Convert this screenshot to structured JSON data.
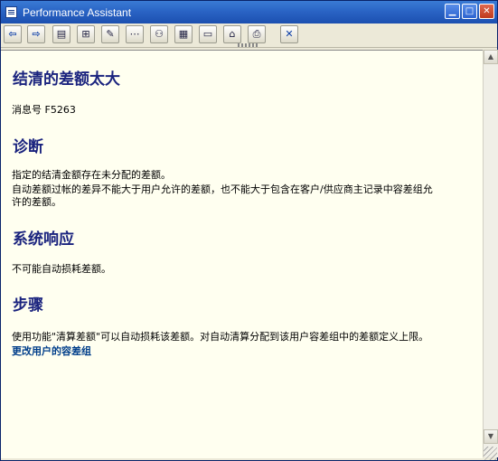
{
  "window": {
    "title": "Performance Assistant"
  },
  "window_controls": {
    "minimize": "▁",
    "maximize": "□",
    "close": "✕"
  },
  "toolbar": [
    {
      "name": "back-button",
      "glyph": "⇦"
    },
    {
      "name": "forward-button",
      "glyph": "⇨"
    },
    {
      "name": "book-button",
      "glyph": "▤"
    },
    {
      "name": "structure-button",
      "glyph": "⊞"
    },
    {
      "name": "edit-button",
      "glyph": "✎"
    },
    {
      "name": "technical-info-button",
      "glyph": "⋯"
    },
    {
      "name": "users-button",
      "glyph": "⚇"
    },
    {
      "name": "table-button",
      "glyph": "▦"
    },
    {
      "name": "sapscript-button",
      "glyph": "▭"
    },
    {
      "name": "settings-button",
      "glyph": "⌂"
    },
    {
      "name": "print-button",
      "glyph": "⎙"
    },
    {
      "name": "close-doc-button",
      "glyph": "✕"
    }
  ],
  "content": {
    "title": "结清的差额太大",
    "message_no": "消息号 F5263",
    "diagnosis_heading": "诊断",
    "diagnosis_text1": "指定的结清金额存在未分配的差额。",
    "diagnosis_text2": "自动差额过帐的差异不能大于用户允许的差额，也不能大于包含在客户/供应商主记录中容差组允",
    "diagnosis_text3": "许的差额。",
    "response_heading": "系统响应",
    "response_text": "不可能自动损耗差额。",
    "steps_heading": "步骤",
    "steps_text": "使用功能\"清算差额\"可以自动损耗该差额。对自动清算分配到该用户容差组中的差额定义上限。",
    "link_text": "更改用户的容差组"
  },
  "scrollbar": {
    "up": "▲",
    "down": "▼"
  }
}
